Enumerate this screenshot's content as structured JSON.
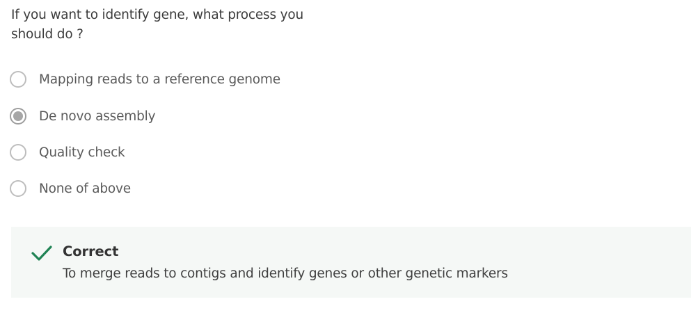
{
  "question": {
    "text": "If you want to identify gene, what process you should do ?"
  },
  "options": [
    {
      "label": "Mapping reads to a reference genome",
      "selected": false
    },
    {
      "label": "De novo assembly",
      "selected": true
    },
    {
      "label": "Quality check",
      "selected": false
    },
    {
      "label": "None of above",
      "selected": false
    }
  ],
  "feedback": {
    "title": "Correct",
    "explanation": "To merge reads to contigs and identify genes or other genetic markers",
    "status_color": "#1f8354",
    "icon": "check-icon"
  }
}
